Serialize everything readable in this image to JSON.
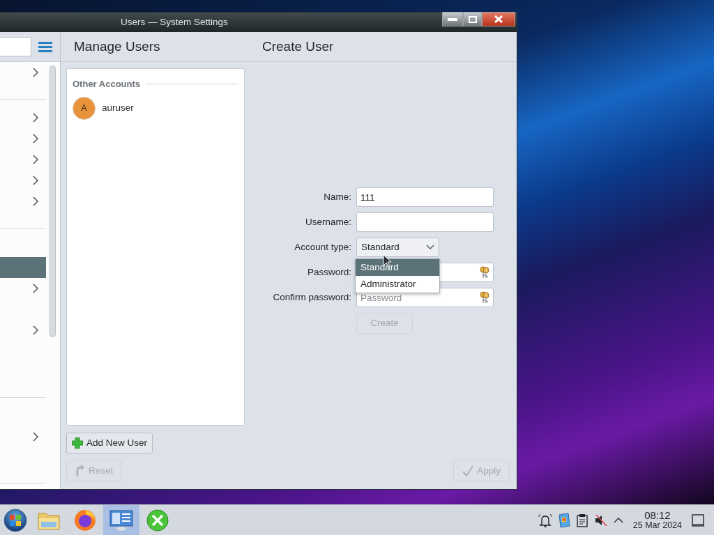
{
  "window": {
    "title": "Users — System Settings"
  },
  "sidebar": {
    "groups": [
      {
        "items": [
          {
            "selected": false,
            "expandable": true
          }
        ]
      },
      {
        "items": [
          {
            "selected": false,
            "expandable": true
          },
          {
            "selected": false,
            "expandable": true
          },
          {
            "selected": false,
            "expandable": true
          },
          {
            "selected": false,
            "expandable": true
          },
          {
            "selected": false,
            "expandable": true
          }
        ]
      },
      {
        "items": [
          {
            "selected": true,
            "expandable": false
          },
          {
            "selected": false,
            "expandable": true
          },
          {
            "selected": false,
            "expandable": true
          }
        ]
      },
      {
        "items": [
          {
            "selected": false,
            "expandable": true
          }
        ]
      }
    ]
  },
  "header": {
    "left_title": "Manage Users",
    "right_title": "Create User"
  },
  "accounts": {
    "heading": "Other Accounts",
    "users": [
      {
        "initial": "A",
        "name": "auruser"
      }
    ]
  },
  "add_user_button": {
    "label": "Add New User"
  },
  "form": {
    "fields": [
      {
        "label": "Name:",
        "kind": "text",
        "value": "111"
      },
      {
        "label": "Username:",
        "kind": "text"
      },
      {
        "label": "Account type:",
        "kind": "combo",
        "value": "Standard",
        "expanded": true,
        "options": [
          {
            "label": "Standard",
            "selected": true
          },
          {
            "label": "Administrator",
            "selected": false
          }
        ]
      },
      {
        "label": "Password:",
        "kind": "password"
      },
      {
        "label": "Confirm password:",
        "kind": "password",
        "placeholder": "Password"
      }
    ],
    "create_button": {
      "label": "Create",
      "disabled": true
    }
  },
  "footer": {
    "reset": {
      "label": "Reset",
      "disabled": true
    },
    "apply": {
      "label": "Apply",
      "disabled": true
    }
  },
  "taskbar": {
    "apps": [
      {
        "kind": "start",
        "selected": false
      },
      {
        "kind": "folder",
        "selected": false
      },
      {
        "kind": "browser",
        "selected": false
      },
      {
        "kind": "settings",
        "selected": true
      },
      {
        "kind": "tools",
        "selected": false
      }
    ],
    "tray": {
      "muted": true
    },
    "clock": {
      "time": "08:12",
      "date": "25 Mar 2024"
    }
  }
}
